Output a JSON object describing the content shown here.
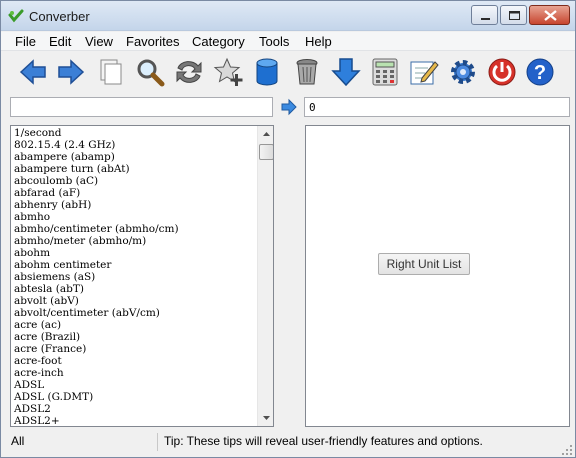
{
  "window": {
    "title": "Converber"
  },
  "menu": {
    "items": [
      "File",
      "Edit",
      "View",
      "Favorites",
      "Category",
      "Tools",
      "Help"
    ]
  },
  "toolbar": {
    "icons": [
      "back-arrow-icon",
      "forward-arrow-icon",
      "copy-icon",
      "search-icon",
      "swap-icon",
      "add-favorite-icon",
      "database-icon",
      "trash-icon",
      "download-icon",
      "calculator-icon",
      "edit-icon",
      "settings-icon",
      "power-icon",
      "help-icon"
    ]
  },
  "conversion": {
    "from_value": "",
    "to_value": "0"
  },
  "left_list": {
    "items": [
      "1/second",
      "802.15.4 (2.4 GHz)",
      "abampere (abamp)",
      "abampere turn (abAt)",
      "abcoulomb (aC)",
      "abfarad (aF)",
      "abhenry (abH)",
      "abmho",
      "abmho/centimeter (abmho/cm)",
      "abmho/meter (abmho/m)",
      "abohm",
      "abohm centimeter",
      "absiemens (aS)",
      "abtesla (abT)",
      "abvolt (abV)",
      "abvolt/centimeter (abV/cm)",
      "acre (ac)",
      "acre (Brazil)",
      "acre (France)",
      "acre-foot",
      "acre-inch",
      "ADSL",
      "ADSL (G.DMT)",
      "ADSL2",
      "ADSL2+"
    ]
  },
  "right_panel": {
    "label": "Right Unit List"
  },
  "status": {
    "category": "All",
    "tip": "Tip: These tips will reveal user-friendly features and options."
  }
}
